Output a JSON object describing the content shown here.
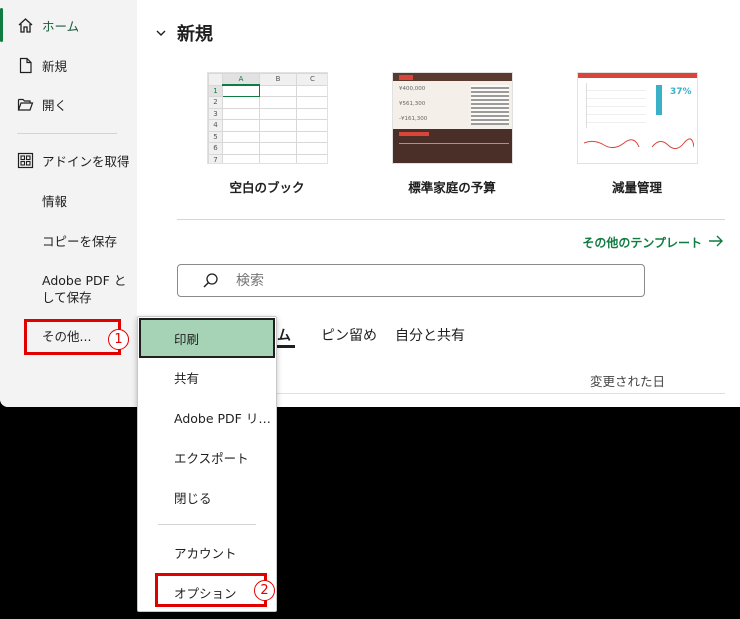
{
  "sidebar": {
    "items": [
      {
        "id": "home",
        "label": "ホーム",
        "icon": "home-icon"
      },
      {
        "id": "new",
        "label": "新規",
        "icon": "new-document-icon"
      },
      {
        "id": "open",
        "label": "開く",
        "icon": "open-folder-icon"
      },
      {
        "id": "addins",
        "label": "アドインを取得",
        "icon": "addins-icon"
      },
      {
        "id": "info",
        "label": "情報"
      },
      {
        "id": "save-copy",
        "label": "コピーを保存"
      },
      {
        "id": "save-pdf",
        "label": "Adobe PDF として保存"
      },
      {
        "id": "more",
        "label": "その他..."
      }
    ]
  },
  "annotations": {
    "step1": "1",
    "step2": "2",
    "highlight_color": "#e00000"
  },
  "main": {
    "section_title": "新規",
    "templates": [
      {
        "name": "空白のブック"
      },
      {
        "name": "標準家庭の予算"
      },
      {
        "name": "減量管理"
      }
    ],
    "more_templates": "その他のテンプレート",
    "search_placeholder": "検索",
    "tabs": [
      {
        "label": "最近使ったアイテム"
      },
      {
        "label": "ピン留め"
      },
      {
        "label": "自分と共有"
      }
    ],
    "visible_tab_fragment": "ム",
    "column_modified": "変更された日"
  },
  "blank_sheet": {
    "cols": [
      "A",
      "B",
      "C"
    ],
    "rows": [
      "1",
      "2",
      "3",
      "4",
      "5",
      "6",
      "7"
    ]
  },
  "budget_thumb": {
    "amount1": "¥400,000",
    "amount2": "¥561,300",
    "amount3": "-¥161,300"
  },
  "weight_thumb": {
    "percent": "37%"
  },
  "menu": {
    "items": [
      {
        "label": "印刷"
      },
      {
        "label": "共有"
      },
      {
        "label": "Adobe PDF リ…"
      },
      {
        "label": "エクスポート"
      },
      {
        "label": "閉じる"
      },
      {
        "label": "アカウント"
      },
      {
        "label": "オプション"
      }
    ]
  },
  "colors": {
    "accent": "#107c41",
    "highlight": "#a6d2b5",
    "annotation": "#e00000"
  }
}
